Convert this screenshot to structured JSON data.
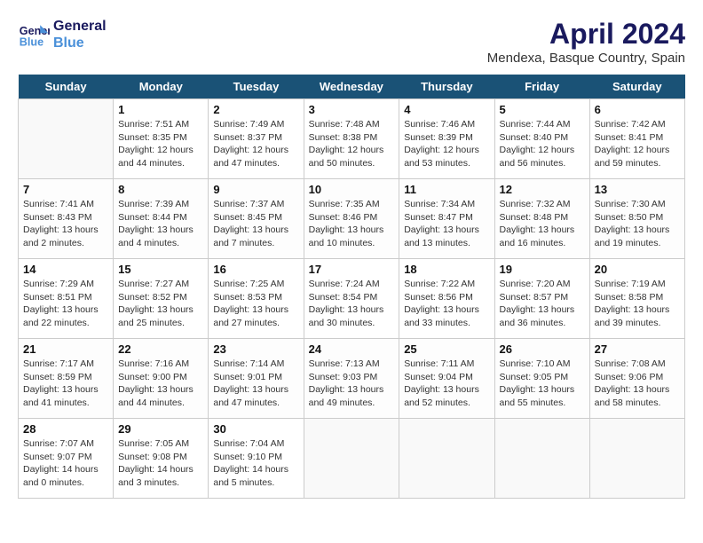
{
  "logo": {
    "line1": "General",
    "line2": "Blue"
  },
  "title": "April 2024",
  "subtitle": "Mendexa, Basque Country, Spain",
  "headers": [
    "Sunday",
    "Monday",
    "Tuesday",
    "Wednesday",
    "Thursday",
    "Friday",
    "Saturday"
  ],
  "weeks": [
    [
      {
        "date": "",
        "info": ""
      },
      {
        "date": "1",
        "info": "Sunrise: 7:51 AM\nSunset: 8:35 PM\nDaylight: 12 hours\nand 44 minutes."
      },
      {
        "date": "2",
        "info": "Sunrise: 7:49 AM\nSunset: 8:37 PM\nDaylight: 12 hours\nand 47 minutes."
      },
      {
        "date": "3",
        "info": "Sunrise: 7:48 AM\nSunset: 8:38 PM\nDaylight: 12 hours\nand 50 minutes."
      },
      {
        "date": "4",
        "info": "Sunrise: 7:46 AM\nSunset: 8:39 PM\nDaylight: 12 hours\nand 53 minutes."
      },
      {
        "date": "5",
        "info": "Sunrise: 7:44 AM\nSunset: 8:40 PM\nDaylight: 12 hours\nand 56 minutes."
      },
      {
        "date": "6",
        "info": "Sunrise: 7:42 AM\nSunset: 8:41 PM\nDaylight: 12 hours\nand 59 minutes."
      }
    ],
    [
      {
        "date": "7",
        "info": "Sunrise: 7:41 AM\nSunset: 8:43 PM\nDaylight: 13 hours\nand 2 minutes."
      },
      {
        "date": "8",
        "info": "Sunrise: 7:39 AM\nSunset: 8:44 PM\nDaylight: 13 hours\nand 4 minutes."
      },
      {
        "date": "9",
        "info": "Sunrise: 7:37 AM\nSunset: 8:45 PM\nDaylight: 13 hours\nand 7 minutes."
      },
      {
        "date": "10",
        "info": "Sunrise: 7:35 AM\nSunset: 8:46 PM\nDaylight: 13 hours\nand 10 minutes."
      },
      {
        "date": "11",
        "info": "Sunrise: 7:34 AM\nSunset: 8:47 PM\nDaylight: 13 hours\nand 13 minutes."
      },
      {
        "date": "12",
        "info": "Sunrise: 7:32 AM\nSunset: 8:48 PM\nDaylight: 13 hours\nand 16 minutes."
      },
      {
        "date": "13",
        "info": "Sunrise: 7:30 AM\nSunset: 8:50 PM\nDaylight: 13 hours\nand 19 minutes."
      }
    ],
    [
      {
        "date": "14",
        "info": "Sunrise: 7:29 AM\nSunset: 8:51 PM\nDaylight: 13 hours\nand 22 minutes."
      },
      {
        "date": "15",
        "info": "Sunrise: 7:27 AM\nSunset: 8:52 PM\nDaylight: 13 hours\nand 25 minutes."
      },
      {
        "date": "16",
        "info": "Sunrise: 7:25 AM\nSunset: 8:53 PM\nDaylight: 13 hours\nand 27 minutes."
      },
      {
        "date": "17",
        "info": "Sunrise: 7:24 AM\nSunset: 8:54 PM\nDaylight: 13 hours\nand 30 minutes."
      },
      {
        "date": "18",
        "info": "Sunrise: 7:22 AM\nSunset: 8:56 PM\nDaylight: 13 hours\nand 33 minutes."
      },
      {
        "date": "19",
        "info": "Sunrise: 7:20 AM\nSunset: 8:57 PM\nDaylight: 13 hours\nand 36 minutes."
      },
      {
        "date": "20",
        "info": "Sunrise: 7:19 AM\nSunset: 8:58 PM\nDaylight: 13 hours\nand 39 minutes."
      }
    ],
    [
      {
        "date": "21",
        "info": "Sunrise: 7:17 AM\nSunset: 8:59 PM\nDaylight: 13 hours\nand 41 minutes."
      },
      {
        "date": "22",
        "info": "Sunrise: 7:16 AM\nSunset: 9:00 PM\nDaylight: 13 hours\nand 44 minutes."
      },
      {
        "date": "23",
        "info": "Sunrise: 7:14 AM\nSunset: 9:01 PM\nDaylight: 13 hours\nand 47 minutes."
      },
      {
        "date": "24",
        "info": "Sunrise: 7:13 AM\nSunset: 9:03 PM\nDaylight: 13 hours\nand 49 minutes."
      },
      {
        "date": "25",
        "info": "Sunrise: 7:11 AM\nSunset: 9:04 PM\nDaylight: 13 hours\nand 52 minutes."
      },
      {
        "date": "26",
        "info": "Sunrise: 7:10 AM\nSunset: 9:05 PM\nDaylight: 13 hours\nand 55 minutes."
      },
      {
        "date": "27",
        "info": "Sunrise: 7:08 AM\nSunset: 9:06 PM\nDaylight: 13 hours\nand 58 minutes."
      }
    ],
    [
      {
        "date": "28",
        "info": "Sunrise: 7:07 AM\nSunset: 9:07 PM\nDaylight: 14 hours\nand 0 minutes."
      },
      {
        "date": "29",
        "info": "Sunrise: 7:05 AM\nSunset: 9:08 PM\nDaylight: 14 hours\nand 3 minutes."
      },
      {
        "date": "30",
        "info": "Sunrise: 7:04 AM\nSunset: 9:10 PM\nDaylight: 14 hours\nand 5 minutes."
      },
      {
        "date": "",
        "info": ""
      },
      {
        "date": "",
        "info": ""
      },
      {
        "date": "",
        "info": ""
      },
      {
        "date": "",
        "info": ""
      }
    ]
  ]
}
